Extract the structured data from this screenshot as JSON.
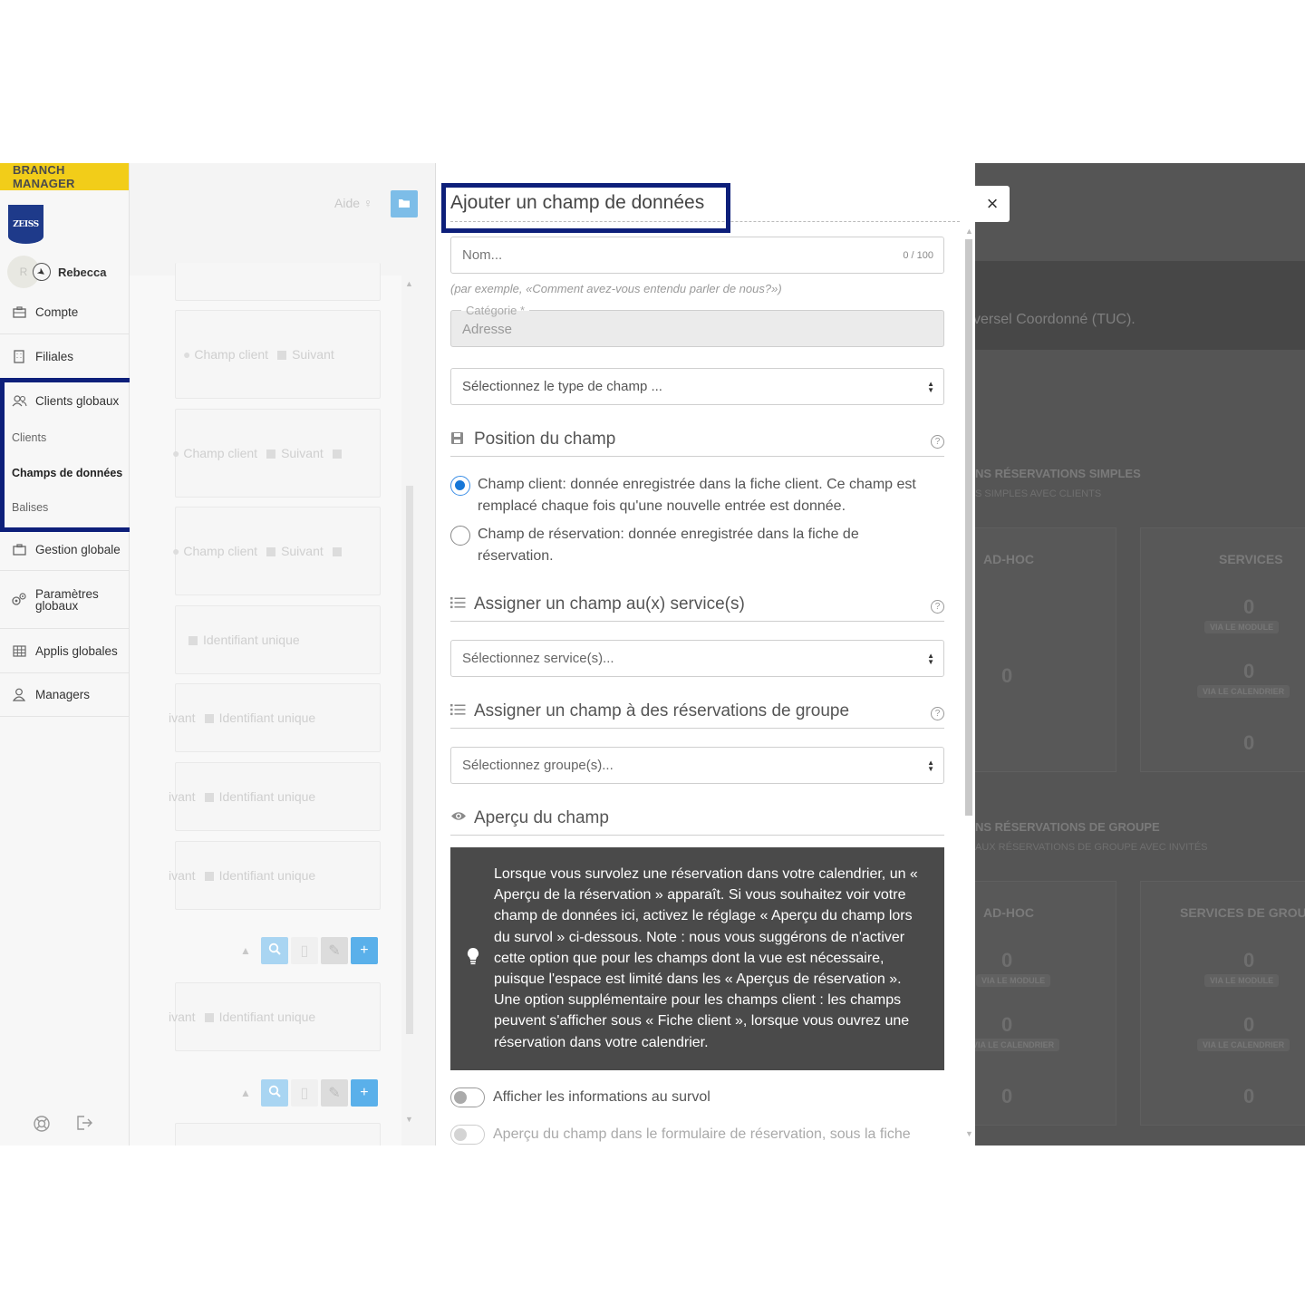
{
  "sidebar": {
    "brand": "BRANCH MANAGER",
    "logo_text": "ZEISS",
    "user": {
      "initial": "R",
      "name": "Rebecca"
    },
    "items": [
      {
        "label": "Compte"
      },
      {
        "label": "Filiales"
      },
      {
        "label": "Clients globaux"
      },
      {
        "label": "Gestion globale"
      },
      {
        "label": "Paramètres globaux"
      },
      {
        "label": "Applis globales"
      },
      {
        "label": "Managers"
      }
    ],
    "subitems": [
      {
        "label": "Clients"
      },
      {
        "label": "Champs de données"
      },
      {
        "label": "Balises"
      }
    ]
  },
  "list_panel": {
    "help_label": "Aide",
    "cards": [
      {
        "field_type": "Champ client",
        "order": "Suivant"
      },
      {
        "field_type": "Champ client",
        "order": "Suivant"
      },
      {
        "field_type": "Champ client",
        "order": "Suivant"
      },
      {
        "tag": "Identifiant unique"
      },
      {
        "order": "ivant",
        "tag": "Identifiant unique"
      },
      {
        "order": "ivant",
        "tag": "Identifiant unique"
      },
      {
        "order": "ivant",
        "tag": "Identifiant unique"
      },
      {
        "order": "ivant",
        "tag": "Identifiant unique"
      }
    ]
  },
  "dialog": {
    "title": "Ajouter un champ de données",
    "name_placeholder": "Nom...",
    "name_counter": "0 / 100",
    "name_hint": "(par exemple, «Comment avez-vous entendu parler de nous?»)",
    "category_label": "Catégorie *",
    "category_value": "Adresse",
    "type_select": "Sélectionnez le type de champ ...",
    "position_section": "Position du champ",
    "radio_client": "Champ client: donnée enregistrée dans la fiche client. Ce champ est remplacé chaque fois qu'une nouvelle entrée est donnée.",
    "radio_reservation": "Champ de réservation: donnée enregistrée dans la fiche de réservation.",
    "services_section": "Assigner un champ au(x) service(s)",
    "services_select": "Sélectionnez service(s)...",
    "groups_section": "Assigner un champ à des réservations de groupe",
    "groups_select": "Sélectionnez groupe(s)...",
    "preview_section": "Aperçu du champ",
    "info_text": "Lorsque vous survolez une réservation dans votre calendrier, un « Aperçu de la réservation » apparaît. Si vous souhaitez voir votre champ de données ici, activez le réglage « Aperçu du champ lors du survol » ci-dessous. Note : nous vous suggérons de n'activer cette option que pour les champs dont la vue est nécessaire, puisque l'espace est limité dans les « Aperçus de réservation ». Une option supplémentaire pour les champs client : les champs peuvent s'afficher sous « Fiche client », lorsque vous ouvrez une réservation dans votre calendrier.",
    "toggle_hover": "Afficher les informations au survol",
    "toggle_form": "Aperçu du champ dans le formulaire de réservation, sous la fiche",
    "close": "×"
  },
  "background": {
    "banner_text": "versel Coordonné (TUC).",
    "simple_title": "NS RÉSERVATIONS SIMPLES",
    "simple_sub": "S SIMPLES AVEC CLIENTS",
    "group_title": "NS RÉSERVATIONS DE GROUPE",
    "group_sub": "AUX RÉSERVATIONS DE GROUPE AVEC INVITÉS",
    "col_adhoc": "AD-HOC",
    "col_services": "SERVICES",
    "col_services_group": "SERVICES DE GROU",
    "badge_module": "VIA LE MODULE",
    "badge_calendar": "VIA LE CALENDRIER",
    "zero": "0"
  },
  "colors": {
    "brand_yellow": "#f2cd19",
    "highlight": "#0d1f7a",
    "radio_blue": "#1677d7",
    "info_bg": "#4a4a4a"
  }
}
